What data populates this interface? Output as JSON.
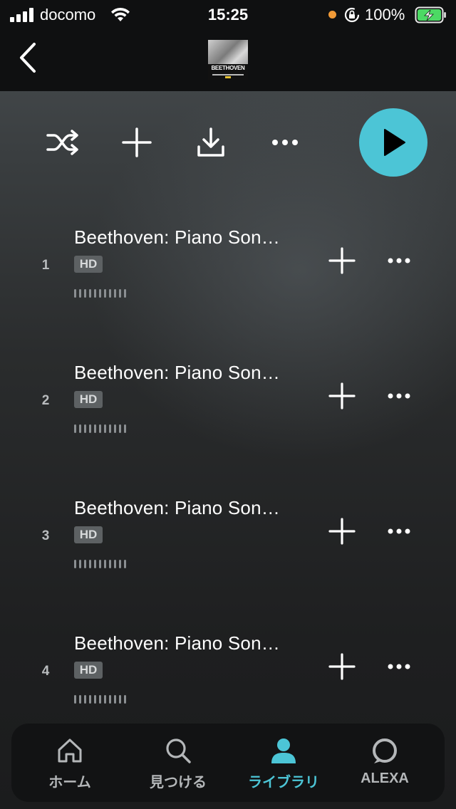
{
  "status_bar": {
    "carrier": "docomo",
    "time": "15:25",
    "battery_percent": "100%",
    "signal_bars": 4
  },
  "header": {
    "album_thumb_text": "BEETHOVEN"
  },
  "actions": {
    "shuffle_icon": "shuffle-icon",
    "add_icon": "plus-icon",
    "download_icon": "download-icon",
    "more_icon": "more-horizontal-icon",
    "play_icon": "play-icon",
    "accent_color": "#4cc5d6"
  },
  "tracks": [
    {
      "number": "1",
      "title": "Beethoven: Piano Son…",
      "quality": "HD"
    },
    {
      "number": "2",
      "title": "Beethoven: Piano Son…",
      "quality": "HD"
    },
    {
      "number": "3",
      "title": "Beethoven: Piano Son…",
      "quality": "HD"
    },
    {
      "number": "4",
      "title": "Beethoven: Piano Son…",
      "quality": "HD"
    }
  ],
  "tab_bar": {
    "tabs": [
      {
        "label": "ホーム",
        "icon": "home-icon",
        "active": false
      },
      {
        "label": "見つける",
        "icon": "search-icon",
        "active": false
      },
      {
        "label": "ライブラリ",
        "icon": "person-icon",
        "active": true
      },
      {
        "label": "ALEXA",
        "icon": "alexa-ring-icon",
        "active": false
      }
    ]
  }
}
